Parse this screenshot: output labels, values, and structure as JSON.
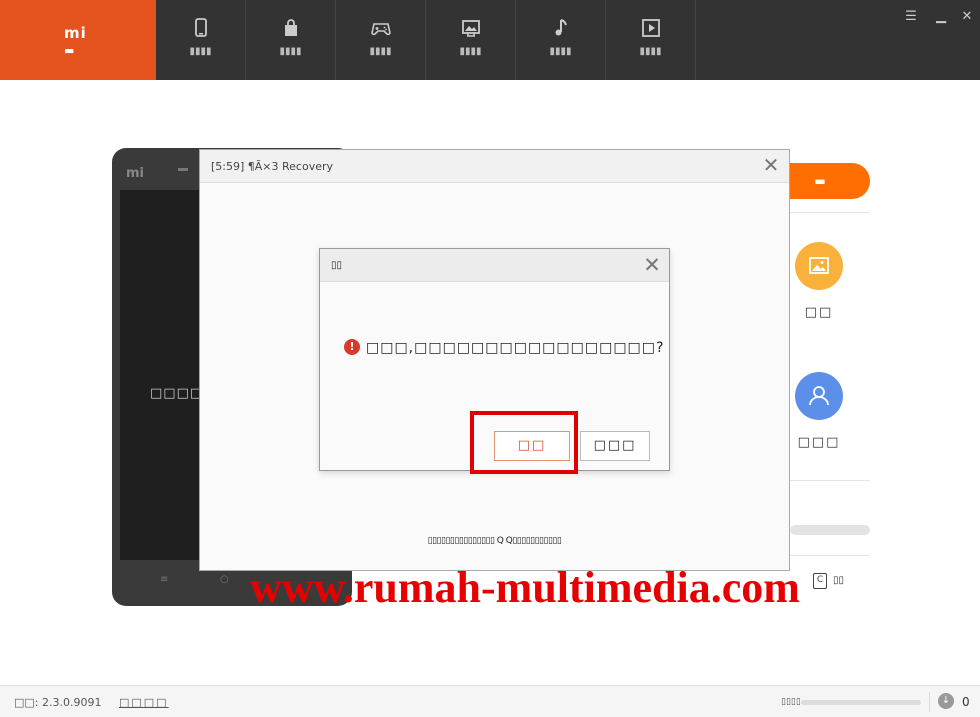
{
  "topbar": {
    "home": {
      "logo": "mi",
      "label": "▬"
    },
    "tabs": [
      {
        "icon": "phone-icon",
        "label": "▮▮▮▮"
      },
      {
        "icon": "bag-icon",
        "label": "▮▮▮▮"
      },
      {
        "icon": "gamepad-icon",
        "label": "▮▮▮▮"
      },
      {
        "icon": "picture-icon",
        "label": "▮▮▮▮"
      },
      {
        "icon": "music-icon",
        "label": "▮▮▮▮"
      },
      {
        "icon": "video-icon",
        "label": "▮▮▮▮"
      }
    ],
    "window_controls": {
      "menu": "☰",
      "minimize": "▁",
      "close": "✕"
    }
  },
  "phone": {
    "logo": "mi",
    "screen_text": "□□□□U",
    "softkeys": [
      "≡",
      "○"
    ]
  },
  "right_panel": {
    "flash_button": "▬",
    "items": [
      {
        "icon": "photo-icon",
        "label": "□□",
        "color": "#f9b13b"
      },
      {
        "icon": "user-icon",
        "label": "□□□",
        "color": "#5b8fe8"
      }
    ],
    "backup_icon": "C",
    "backup_label": "▯▯"
  },
  "recovery_window": {
    "title": "[5:59] ¶Ã×3 Recovery",
    "close": "✕",
    "footer": "▯▯▯▯▯▯▯▯▯▯▯▯▯▯▯ Q Q▯▯▯▯▯▯▯▯▯▯▯"
  },
  "dialog": {
    "title": "▯▯",
    "close": "✕",
    "warning_icon": "!",
    "message": "□□□,□□□□□□□□□□□□□□□□□?",
    "confirm_button": "□□",
    "cancel_button": "□□□"
  },
  "watermark": "www.rumah-multimedia.com",
  "statusbar": {
    "version": "□□: 2.3.0.9091",
    "link": "□□□□",
    "speed_label": "▯▯▯▯",
    "download_icon": "↓",
    "download_count": "0"
  },
  "colors": {
    "accent": "#e4521d",
    "topbar": "#333333",
    "flash": "#ff6e00",
    "highlight": "#e00000"
  }
}
